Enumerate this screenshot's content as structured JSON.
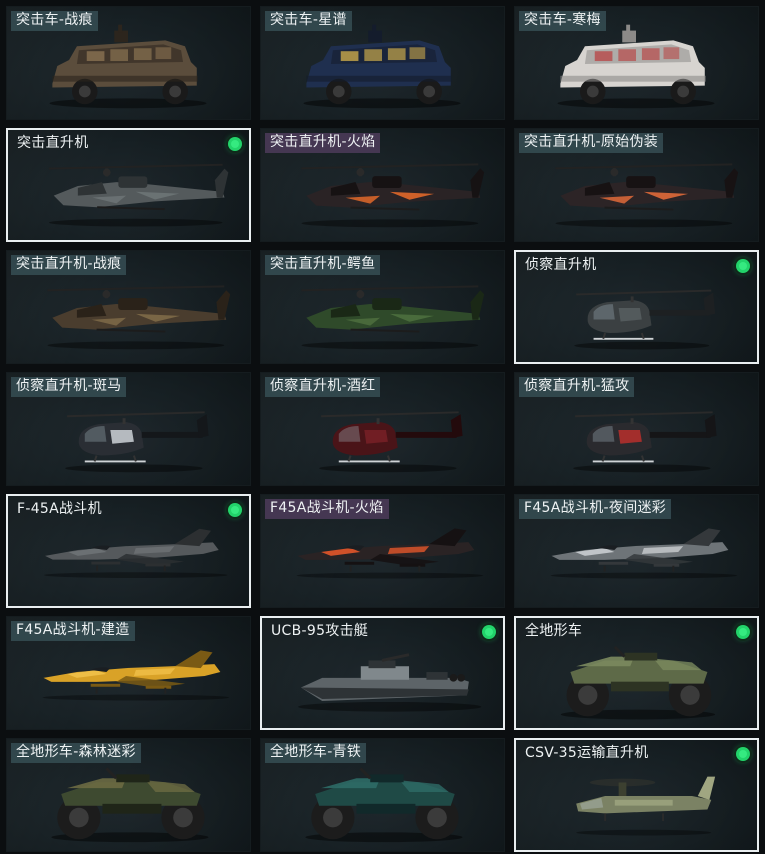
{
  "items": [
    {
      "label": "突击车-战痕",
      "type": "armored-car",
      "selected": false,
      "equipped": false,
      "tag": "teal",
      "skin": {
        "body": "#5b4d3c",
        "accent": "#8a7352",
        "dark": "#2c251d"
      }
    },
    {
      "label": "突击车-星谱",
      "type": "armored-car",
      "selected": false,
      "equipped": false,
      "tag": "teal",
      "skin": {
        "body": "#1f2f4f",
        "accent": "#c9a94b",
        "dark": "#141c2c"
      }
    },
    {
      "label": "突击车-寒梅",
      "type": "armored-car",
      "selected": false,
      "equipped": false,
      "tag": "teal",
      "skin": {
        "body": "#d7d4d0",
        "accent": "#b84a4a",
        "dark": "#8c8a88"
      }
    },
    {
      "label": "突击直升机",
      "type": "attack-heli",
      "selected": true,
      "equipped": true,
      "tag": "none",
      "skin": {
        "body": "#545a5c",
        "accent": "#6d7476",
        "dark": "#2e3335"
      }
    },
    {
      "label": "突击直升机-火焰",
      "type": "attack-heli",
      "selected": false,
      "equipped": false,
      "tag": "purple",
      "skin": {
        "body": "#2a2325",
        "accent": "#e0682a",
        "dark": "#161213"
      }
    },
    {
      "label": "突击直升机-原始伪装",
      "type": "attack-heli",
      "selected": false,
      "equipped": false,
      "tag": "teal",
      "skin": {
        "body": "#2c2426",
        "accent": "#e06a3a",
        "dark": "#171213"
      }
    },
    {
      "label": "突击直升机-战痕",
      "type": "attack-heli",
      "selected": false,
      "equipped": false,
      "tag": "teal",
      "skin": {
        "body": "#4a3d2e",
        "accent": "#7e6a48",
        "dark": "#2a2219"
      }
    },
    {
      "label": "突击直升机-鳄鱼",
      "type": "attack-heli",
      "selected": false,
      "equipped": false,
      "tag": "teal",
      "skin": {
        "body": "#2f4a2a",
        "accent": "#4d6f3e",
        "dark": "#1a2816"
      }
    },
    {
      "label": "侦察直升机",
      "type": "scout-heli",
      "selected": true,
      "equipped": true,
      "tag": "none",
      "skin": {
        "body": "#3b4042",
        "accent": "#5a6063",
        "dark": "#1d2022"
      }
    },
    {
      "label": "侦察直升机-斑马",
      "type": "scout-heli",
      "selected": false,
      "equipped": false,
      "tag": "teal",
      "skin": {
        "body": "#2a2e34",
        "accent": "#d8dde2",
        "dark": "#14171a"
      }
    },
    {
      "label": "侦察直升机-酒红",
      "type": "scout-heli",
      "selected": false,
      "equipped": false,
      "tag": "teal",
      "skin": {
        "body": "#4a1418",
        "accent": "#7a2128",
        "dark": "#230a0c"
      }
    },
    {
      "label": "侦察直升机-猛攻",
      "type": "scout-heli",
      "selected": false,
      "equipped": false,
      "tag": "teal",
      "skin": {
        "body": "#2a2a2e",
        "accent": "#c2302c",
        "dark": "#151517"
      }
    },
    {
      "label": "F-45A战斗机",
      "type": "fighter",
      "selected": true,
      "equipped": true,
      "tag": "none",
      "skin": {
        "body": "#55595c",
        "accent": "#6e7275",
        "dark": "#2c2f31"
      }
    },
    {
      "label": "F45A战斗机-火焰",
      "type": "fighter",
      "selected": false,
      "equipped": false,
      "tag": "purple",
      "skin": {
        "body": "#2a2324",
        "accent": "#e4562a",
        "dark": "#151112"
      }
    },
    {
      "label": "F45A战斗机-夜间迷彩",
      "type": "fighter",
      "selected": false,
      "equipped": false,
      "tag": "teal",
      "skin": {
        "body": "#6e7478",
        "accent": "#c9cdd0",
        "dark": "#34383b"
      }
    },
    {
      "label": "F45A战斗机-建造",
      "type": "fighter",
      "selected": false,
      "equipped": false,
      "tag": "teal",
      "skin": {
        "body": "#d9a227",
        "accent": "#f0c14a",
        "dark": "#7a5a14"
      }
    },
    {
      "label": "UCB-95攻击艇",
      "type": "boat",
      "selected": true,
      "equipped": true,
      "tag": "none",
      "skin": {
        "body": "#5d6468",
        "accent": "#80888c",
        "dark": "#2e3336"
      }
    },
    {
      "label": "全地形车",
      "type": "atv",
      "selected": true,
      "equipped": true,
      "tag": "none",
      "skin": {
        "body": "#5e6a48",
        "accent": "#7b8a5e",
        "dark": "#2d3323"
      }
    },
    {
      "label": "全地形车-森林迷彩",
      "type": "atv",
      "selected": false,
      "equipped": false,
      "tag": "teal",
      "skin": {
        "body": "#3e4a30",
        "accent": "#6b6a42",
        "dark": "#1f2518"
      }
    },
    {
      "label": "全地形车-青铁",
      "type": "atv",
      "selected": false,
      "equipped": false,
      "tag": "teal",
      "skin": {
        "body": "#1f4a46",
        "accent": "#2e6c66",
        "dark": "#11292a"
      }
    },
    {
      "label": "CSV-35运输直升机",
      "type": "tiltrotor",
      "selected": true,
      "equipped": true,
      "tag": "none",
      "skin": {
        "body": "#7b8264",
        "accent": "#a0a681",
        "dark": "#3c4030"
      }
    }
  ]
}
